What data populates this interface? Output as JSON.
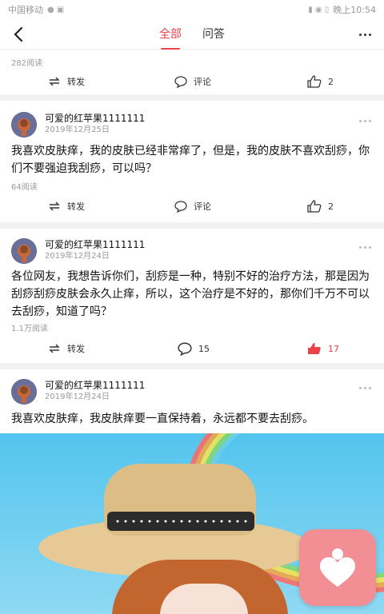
{
  "status_bar": {
    "carrier": "中国移动",
    "time": "晚上10:54"
  },
  "nav": {
    "tabs": [
      {
        "label": "全部",
        "active": true
      },
      {
        "label": "问答",
        "active": false
      }
    ]
  },
  "colors": {
    "accent": "#e9424b",
    "fab": "#f28f95"
  },
  "posts": [
    {
      "reads": "282阅读",
      "actions": {
        "repost": "转发",
        "comment": "评论",
        "like": "2"
      }
    },
    {
      "author": "可爱的红苹果1111111",
      "date": "2019年12月25日",
      "text": "我喜欢皮肤痒，我的皮肤已经非常痒了，但是，我的皮肤不喜欢刮痧，你们不要强迫我刮痧，可以吗？",
      "reads": "64阅读",
      "actions": {
        "repost": "转发",
        "comment": "评论",
        "like": "2"
      }
    },
    {
      "author": "可爱的红苹果1111111",
      "date": "2019年12月24日",
      "text": "各位网友，我想告诉你们，刮痧是一种，特别不好的治疗方法，那是因为刮痧刮痧皮肤会永久止痒，所以，这个治疗是不好的，那你们千万不可以去刮痧，知道了吗？",
      "reads": "1.1万阅读",
      "actions": {
        "repost": "转发",
        "comment": "15",
        "like": "17"
      }
    },
    {
      "author": "可爱的红苹果1111111",
      "date": "2019年12月24日",
      "text": "我喜欢皮肤痒，我皮肤痒要一直保持着，永远都不要去刮痧。"
    }
  ]
}
